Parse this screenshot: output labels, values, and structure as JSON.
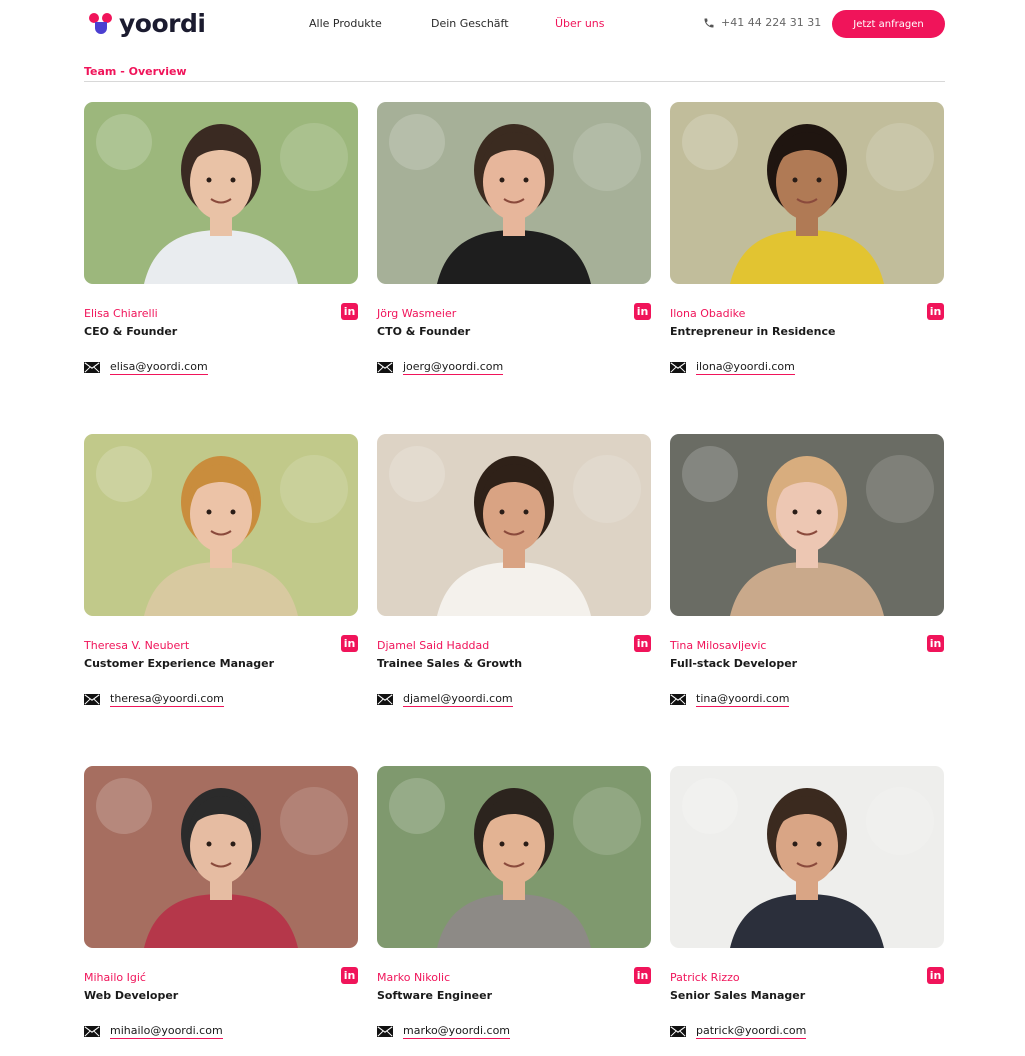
{
  "header": {
    "logo_text": "yoordi",
    "nav": [
      "Alle Produkte",
      "Dein Geschäft",
      "Über uns"
    ],
    "active_nav": "Über uns",
    "phone": "+41 44 224 31 31",
    "cta_label": "Jetzt anfragen"
  },
  "section": {
    "title": "Team - Overview"
  },
  "team": [
    {
      "name": "Elisa Chiarelli",
      "role": "CEO & Founder",
      "email": "elisa@yoordi.com",
      "bg": "#8fae6a",
      "skin": "#e9c2a6",
      "hair": "#3a2a22",
      "shirt": "#e9ecef"
    },
    {
      "name": "Jörg Wasmeier",
      "role": "CTO & Founder",
      "email": "joerg@yoordi.com",
      "bg": "#9aa68a",
      "skin": "#e7b69b",
      "hair": "#3b2b20",
      "shirt": "#1e1e1e"
    },
    {
      "name": "Ilona Obadike",
      "role": "Entrepreneur in Residence",
      "email": "ilona@yoordi.com",
      "bg": "#b9b48e",
      "skin": "#b07a55",
      "hair": "#1f1510",
      "shirt": "#e2c431"
    },
    {
      "name": "Theresa V. Neubert",
      "role": "Customer Experience Manager",
      "email": "theresa@yoordi.com",
      "bg": "#b9c27a",
      "skin": "#ecc3a7",
      "hair": "#c98d3d",
      "shirt": "#d8c9a0"
    },
    {
      "name": "Djamel Said Haddad",
      "role": "Trainee Sales & Growth",
      "email": "djamel@yoordi.com",
      "bg": "#d9cdbd",
      "skin": "#d9a383",
      "hair": "#2f2118",
      "shirt": "#f4f1ec"
    },
    {
      "name": "Tina Milosavljevic",
      "role": "Full-stack Developer",
      "email": "tina@yoordi.com",
      "bg": "#56584f",
      "skin": "#edc7b3",
      "hair": "#d8ad7e",
      "shirt": "#c9a98b"
    },
    {
      "name": "Mihailo Igić",
      "role": "Web Developer",
      "email": "mihailo@yoordi.com",
      "bg": "#9a5a4a",
      "skin": "#e6bca2",
      "hair": "#2b2b2b",
      "shirt": "#b5374a"
    },
    {
      "name": "Marko Nikolic",
      "role": "Software Engineer",
      "email": "marko@yoordi.com",
      "bg": "#6e8b5a",
      "skin": "#e3b393",
      "hair": "#2c241e",
      "shirt": "#8d8a86"
    },
    {
      "name": "Patrick Rizzo",
      "role": "Senior Sales Manager",
      "email": "patrick@yoordi.com",
      "bg": "#ececea",
      "skin": "#d9a585",
      "hair": "#3b2a1f",
      "shirt": "#2b2f3b"
    }
  ]
}
